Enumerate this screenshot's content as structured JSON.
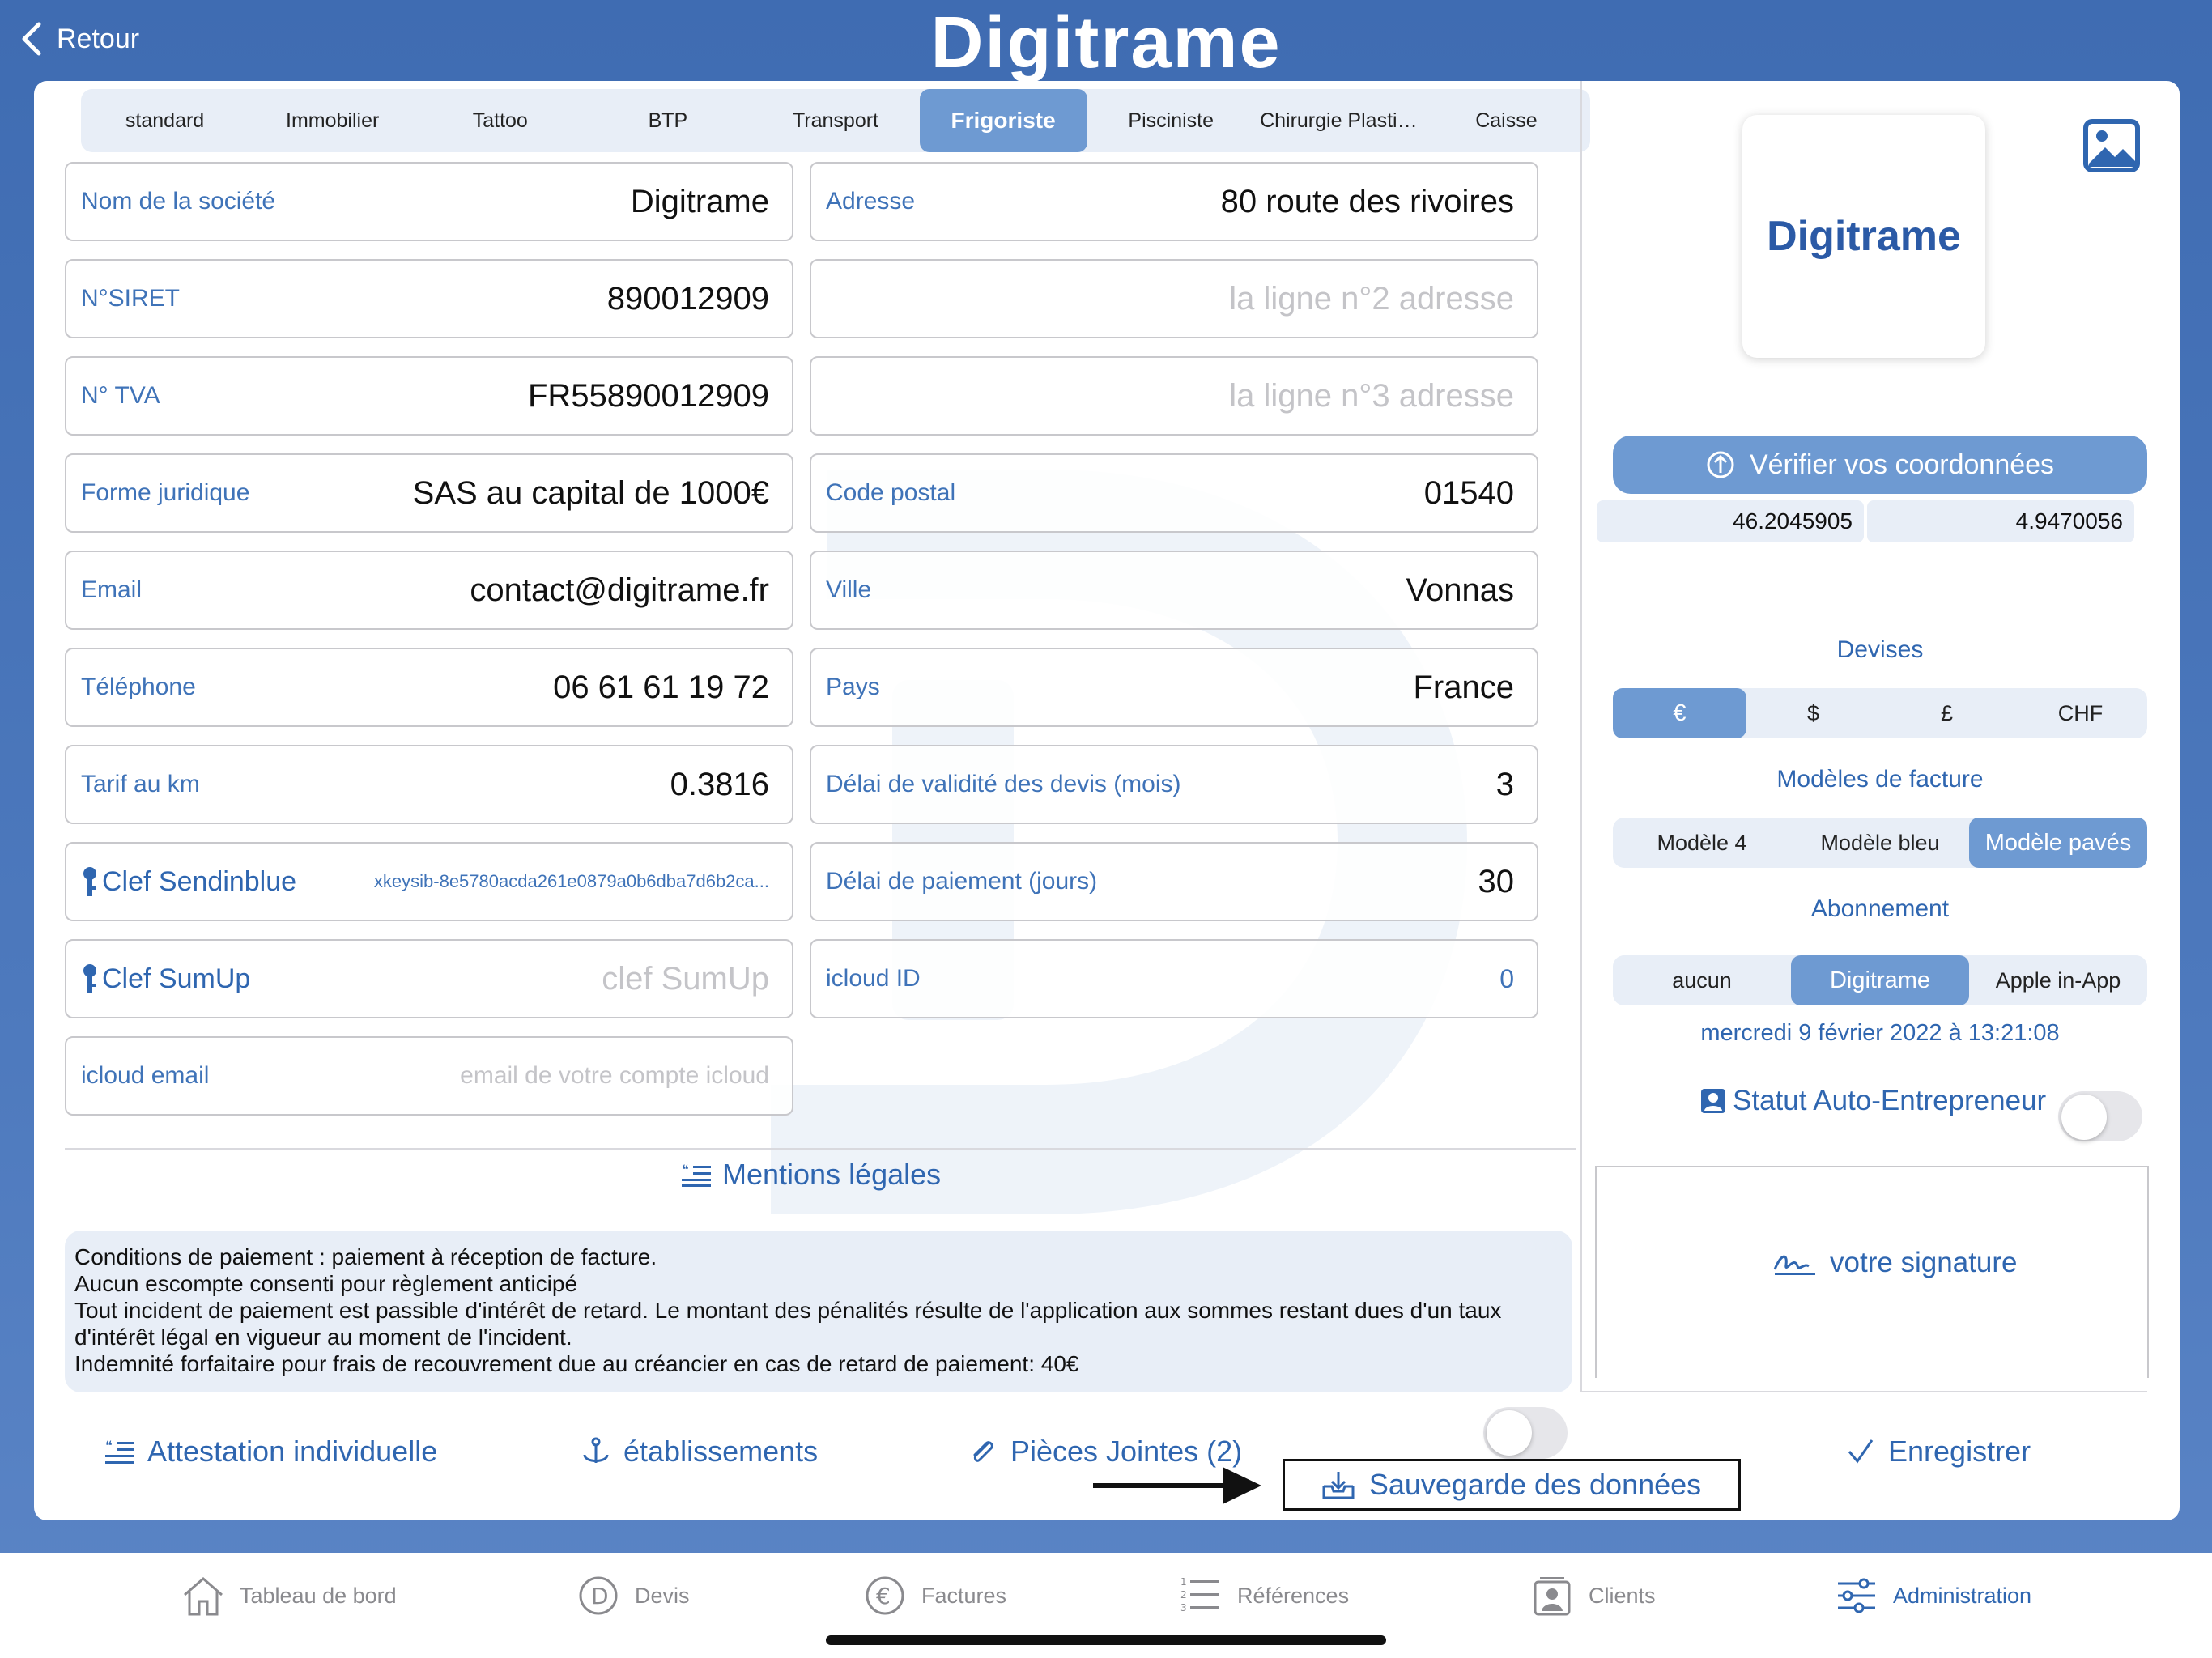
{
  "header": {
    "back_label": "Retour",
    "title": "Digitrame"
  },
  "tabs": [
    {
      "label": "standard"
    },
    {
      "label": "Immobilier"
    },
    {
      "label": "Tattoo"
    },
    {
      "label": "BTP"
    },
    {
      "label": "Transport"
    },
    {
      "label": "Frigoriste"
    },
    {
      "label": "Pisciniste"
    },
    {
      "label": "Chirurgie Plasti…"
    },
    {
      "label": "Caisse"
    }
  ],
  "active_tab": "Frigoriste",
  "fields_left": {
    "company": {
      "label": "Nom de la société",
      "value": "Digitrame"
    },
    "siret": {
      "label": "N°SIRET",
      "value": "890012909"
    },
    "tva": {
      "label": "N° TVA",
      "value": "FR55890012909"
    },
    "legal_form": {
      "label": "Forme juridique",
      "value": "SAS au capital de 1000€"
    },
    "email": {
      "label": "Email",
      "value": "contact@digitrame.fr"
    },
    "phone": {
      "label": "Téléphone",
      "value": "06 61 61 19 72"
    },
    "km_rate": {
      "label": "Tarif au km",
      "value": "0.3816"
    },
    "sendinblue": {
      "label": "Clef Sendinblue",
      "value": "xkeysib-8e5780acda261e0879a0b6dba7d6b2ca..."
    },
    "sumup": {
      "label": "Clef SumUp",
      "placeholder": "clef SumUp"
    },
    "icloud_email": {
      "label": "icloud email",
      "placeholder": "email de votre compte icloud"
    }
  },
  "fields_right": {
    "address": {
      "label": "Adresse",
      "value": "80 route des rivoires"
    },
    "address2": {
      "placeholder": "la ligne n°2 adresse"
    },
    "address3": {
      "placeholder": "la ligne n°3 adresse"
    },
    "postal": {
      "label": "Code postal",
      "value": "01540"
    },
    "city": {
      "label": "Ville",
      "value": "Vonnas"
    },
    "country": {
      "label": "Pays",
      "value": "France"
    },
    "quote_validity": {
      "label": "Délai de validité des devis (mois)",
      "value": "3"
    },
    "payment_delay": {
      "label": "Délai de paiement (jours)",
      "value": "30"
    },
    "icloud_id": {
      "label": "icloud ID",
      "value": "0"
    }
  },
  "mentions": {
    "title": "Mentions légales",
    "lines": [
      "Conditions de paiement : paiement à réception de facture.",
      "Aucun escompte consenti pour règlement anticipé",
      "Tout incident de paiement est passible d'intérêt de retard. Le montant des pénalités résulte de l'application aux sommes restant dues d'un taux d'intérêt légal en vigueur au moment de l'incident.",
      "Indemnité forfaitaire pour frais de recouvrement due au créancier en cas de retard de paiement: 40€"
    ]
  },
  "actions": {
    "attestation": "Attestation individuelle",
    "etablissements": "établissements",
    "pieces_jointes": "Pièces Jointes (2)",
    "sauvegarde": "Sauvegarde des données",
    "enregistrer": "Enregistrer"
  },
  "right_panel": {
    "logo_text": "Digitrame",
    "verify_label": "Vérifier vos coordonnées",
    "latitude": "46.2045905",
    "longitude": "4.9470056",
    "devises_title": "Devises",
    "devises": [
      "€",
      "$",
      "£",
      "CHF"
    ],
    "devise_active": "€",
    "modeles_title": "Modèles de facture",
    "modeles": [
      "Modèle 4",
      "Modèle bleu",
      "Modèle pavés"
    ],
    "modele_active": "Modèle pavés",
    "abonnement_title": "Abonnement",
    "abonnements": [
      "aucun",
      "Digitrame",
      "Apple in-App"
    ],
    "abonnement_active": "Digitrame",
    "date": "mercredi 9 février 2022 à 13:21:08",
    "status_label": "Statut Auto-Entrepreneur",
    "status_on": false,
    "signature_label": "votre signature"
  },
  "tabbar": [
    {
      "label": "Tableau de bord",
      "icon": "home-icon"
    },
    {
      "label": "Devis",
      "icon": "devis-icon"
    },
    {
      "label": "Factures",
      "icon": "euro-icon"
    },
    {
      "label": "Références",
      "icon": "numbered-list-icon"
    },
    {
      "label": "Clients",
      "icon": "clients-icon"
    },
    {
      "label": "Administration",
      "icon": "sliders-icon"
    }
  ],
  "tabbar_active": "Administration",
  "colors": {
    "accent": "#6e9ad2",
    "link": "#2f66b0",
    "label": "#3f73b8",
    "background": "#4d79bd"
  }
}
